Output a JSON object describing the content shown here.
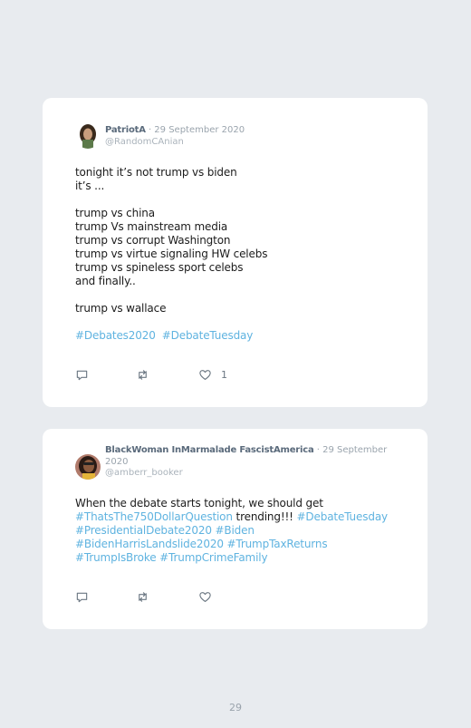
{
  "tweets": [
    {
      "author": "PatriotA",
      "date": "· 29 September 2020",
      "handle": "@RandomCAnian",
      "lines": [
        "tonight it’s not trump vs biden",
        "it’s ...",
        "",
        "trump vs china",
        "trump Vs mainstream media",
        "trump vs corrupt Washington",
        "trump vs virtue signaling HW celebs",
        "trump vs spineless sport celebs",
        "and finally..",
        "",
        "trump vs wallace"
      ],
      "hashtags": [
        "#Debates2020",
        "#DebateTuesday"
      ],
      "likes": "1"
    },
    {
      "author": "BlackWoman InMarmalade FascistAmerica",
      "date": "· 29 September 2020",
      "handle": "@amberr_booker",
      "text": {
        "l1": "When the debate starts tonight, we should get",
        "tag1": "#ThatsThe750DollarQuestion",
        "mid": "trending!!!",
        "tag2": "#DebateTuesday",
        "tag3": "#PresidentialDebate2020",
        "tag4": "#Biden",
        "tag5": "#BidenHarrisLandslide2020",
        "tag6": "#TrumpTaxReturns",
        "tag7": "#TrumpIsBroke",
        "tag8": "#TrumpCrimeFamily"
      },
      "likes": ""
    }
  ],
  "colors": {
    "hashtag": "#5fb3e0",
    "background": "#e8ebef",
    "card": "#ffffff"
  },
  "icons": [
    "reply-icon",
    "retweet-icon",
    "like-icon"
  ],
  "page_number": "29"
}
